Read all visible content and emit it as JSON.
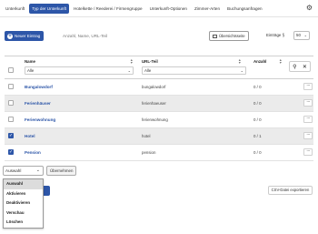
{
  "tabs": [
    {
      "label": "Unterkunft",
      "active": false
    },
    {
      "label": "Typ der Unterkunft",
      "active": true
    },
    {
      "label": "Hotelkette / Reederei / Firmengruppe",
      "active": false
    },
    {
      "label": "Unterkunft-Optionen",
      "active": false
    },
    {
      "label": "Zimmer-Arten",
      "active": false
    },
    {
      "label": "Buchungsanfragen",
      "active": false
    }
  ],
  "toolbar": {
    "new_label": "Neuer Eintrag",
    "search_placeholder": "Anzahl, Name, URL-Teil",
    "overview_label": "Übersichtsseite",
    "entries_label": "Einträge §",
    "entries_value": "50"
  },
  "table": {
    "columns": [
      "Name",
      "URL-Teil",
      "Anzahl"
    ],
    "filters": {
      "name": "Alle",
      "url": "Alle"
    },
    "rows": [
      {
        "name": "Bungalowdorf",
        "url": "bungalowdorf",
        "count": "0 / 0",
        "checked": false
      },
      {
        "name": "Ferienhäuser",
        "url": "ferienhaeuser",
        "count": "0 / 0",
        "checked": false
      },
      {
        "name": "Ferienwohnung",
        "url": "ferienwohnung",
        "count": "0 / 0",
        "checked": false
      },
      {
        "name": "Hotel",
        "url": "hotel",
        "count": "0 / 1",
        "checked": true
      },
      {
        "name": "Pension",
        "url": "pension",
        "count": "0 / 0",
        "checked": true
      }
    ]
  },
  "bulk": {
    "selected": "Auswahl",
    "apply_label": "Übernehmen",
    "options": [
      "Auswahl",
      "Aktivieren",
      "Deaktivieren",
      "Verschau",
      "Löschen"
    ]
  },
  "export_label": "CSV-Datei exportieren",
  "colors": {
    "accent": "#2d56a8"
  }
}
